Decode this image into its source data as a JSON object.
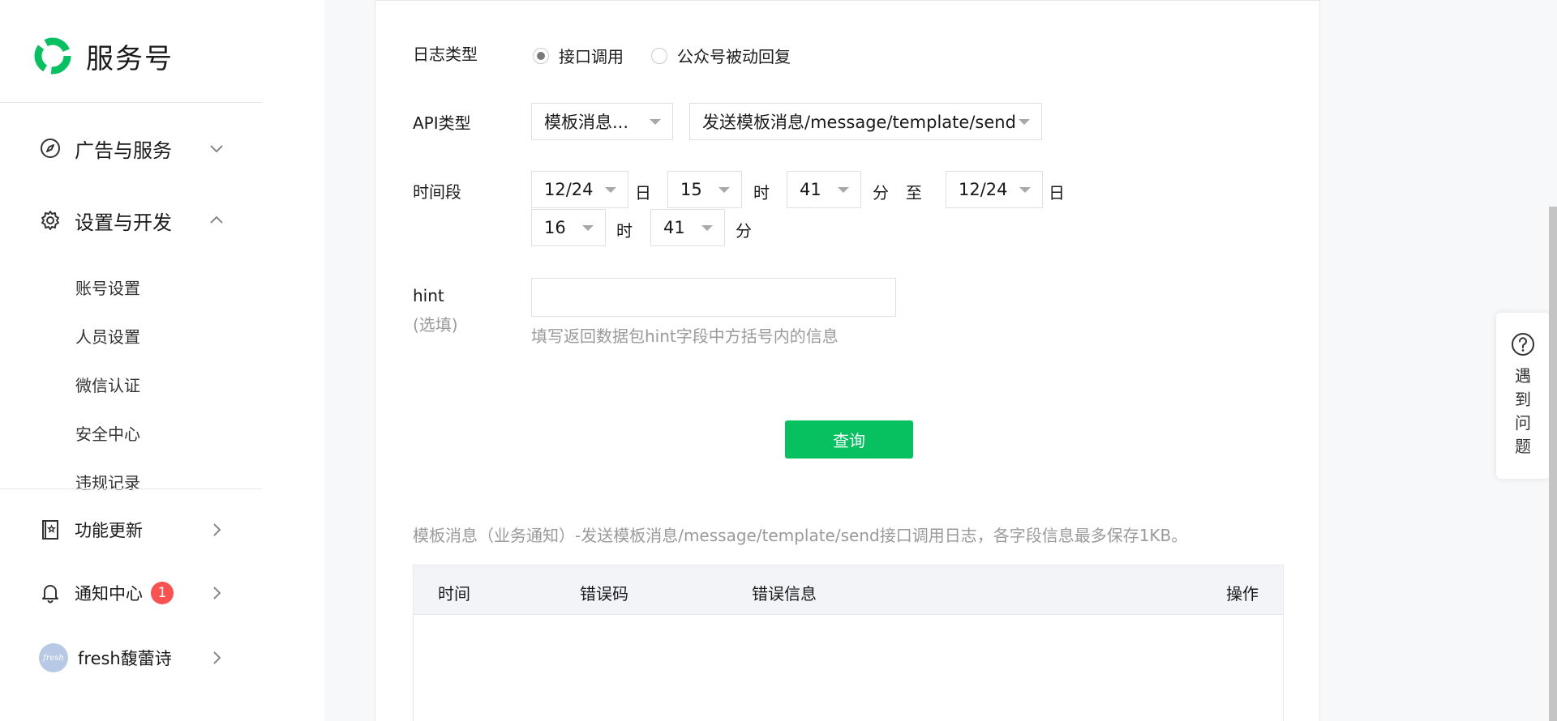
{
  "app": {
    "name": "服务号"
  },
  "sidebar": {
    "groups": [
      {
        "label": "广告与服务"
      },
      {
        "label": "设置与开发"
      }
    ],
    "sub_items": [
      "账号设置",
      "人员设置",
      "微信认证",
      "安全中心",
      "违规记录"
    ],
    "bottom": [
      {
        "label": "功能更新"
      },
      {
        "label": "通知中心",
        "badge": "1"
      },
      {
        "label": "fresh馥蕾诗",
        "avatar_text": "fresh"
      }
    ]
  },
  "form": {
    "log_type": {
      "label": "日志类型",
      "options": [
        "接口调用",
        "公众号被动回复"
      ],
      "selected": "接口调用"
    },
    "api_type": {
      "label": "API类型",
      "category": "模板消息...",
      "endpoint": "发送模板消息/message/template/send"
    },
    "time": {
      "label": "时间段",
      "start_date": "12/24",
      "start_hour": "15",
      "start_minute": "41",
      "end_date": "12/24",
      "end_hour": "16",
      "end_minute": "41",
      "unit_day": "日",
      "unit_hour": "时",
      "unit_minute": "分",
      "to": "至"
    },
    "hint": {
      "label": "hint",
      "optional": "(选填)",
      "value": "",
      "help": "填写返回数据包hint字段中方括号内的信息"
    },
    "query_button": "查询"
  },
  "result": {
    "description": "模板消息（业务通知）-发送模板消息/message/template/send接口调用日志，各字段信息最多保存1KB。",
    "columns": [
      "时间",
      "错误码",
      "错误信息",
      "操作"
    ]
  },
  "help_float": {
    "text": "遇到问题"
  },
  "colors": {
    "primary": "#07c160",
    "badge": "#fa5151"
  }
}
